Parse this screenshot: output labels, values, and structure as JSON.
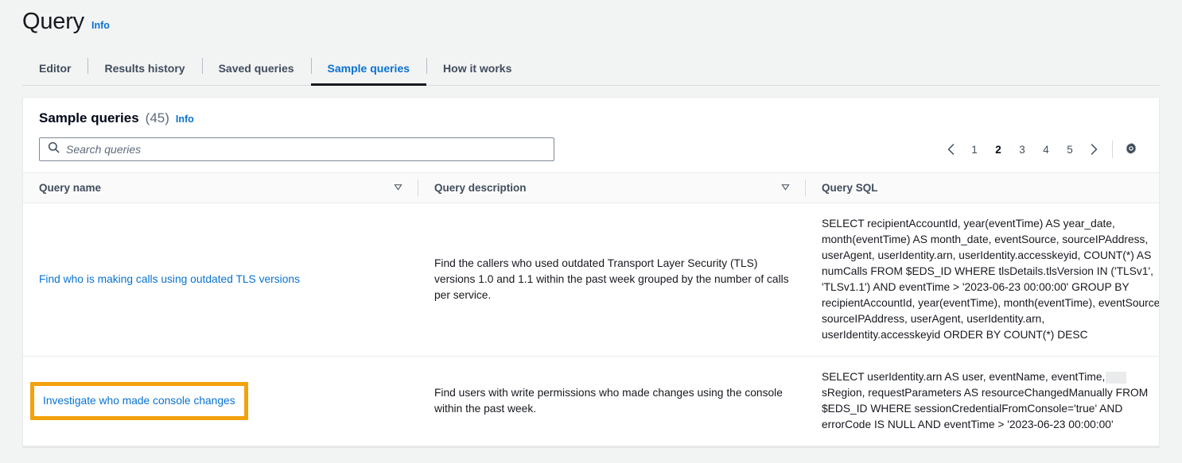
{
  "header": {
    "title": "Query",
    "info_label": "Info"
  },
  "tabs": [
    {
      "label": "Editor",
      "active": false
    },
    {
      "label": "Results history",
      "active": false
    },
    {
      "label": "Saved queries",
      "active": false
    },
    {
      "label": "Sample queries",
      "active": true
    },
    {
      "label": "How it works",
      "active": false
    }
  ],
  "panel": {
    "title": "Sample queries",
    "count": "(45)",
    "info_label": "Info"
  },
  "search": {
    "placeholder": "Search queries",
    "value": "",
    "icon": "search-icon"
  },
  "pagination": {
    "prev_icon": "chevron-left-icon",
    "next_icon": "chevron-right-icon",
    "pages": [
      "1",
      "2",
      "3",
      "4",
      "5"
    ],
    "current_page": "2",
    "settings_icon": "gear-icon"
  },
  "table": {
    "columns": [
      {
        "label": "Query name",
        "sortable": true
      },
      {
        "label": "Query description",
        "sortable": true
      },
      {
        "label": "Query SQL",
        "sortable": false
      }
    ],
    "rows": [
      {
        "name": "Find who is making calls using outdated TLS versions",
        "description": "Find the callers who used outdated Transport Layer Security (TLS) versions 1.0 and 1.1 within the past week grouped by the number of calls per service.",
        "sql_part1": "SELECT recipientAccountId, year(eventTime) AS year_date, month(eventTime) AS month_date, eventSource, sourceIPAddress, userAgent, userIdentity.arn, userIdentity.accesskeyid, COUNT(*) AS numCalls FROM $EDS_ID WHERE tlsDetails.tlsVersion IN ('TLSv1', 'TLSv1.1') AND eventTime > '2023-06-23 00:00:00' GROUP BY recipientAccountId, year(eventTime), month(eventTime), eventSource, sourceIPAddress, userAgent, userIdentity.arn, userIdentity.accesskeyid ORDER BY COUNT(*) DESC",
        "sql_part2": "",
        "highlighted": false,
        "redacted": false
      },
      {
        "name": "Investigate who made console changes",
        "description": "Find users with write permissions who made changes using the console within the past week.",
        "sql_part1": "SELECT userIdentity.arn AS user, eventName, eventTime,",
        "sql_part2": "sRegion, requestParameters AS resourceChangedManually FROM $EDS_ID WHERE sessionCredentialFromConsole='true' AND errorCode IS NULL AND eventTime > '2023-06-23 00:00:00'",
        "highlighted": true,
        "redacted": true
      }
    ]
  },
  "colors": {
    "link": "#0972d3",
    "page_background": "#f2f3f3",
    "panel_background": "#ffffff",
    "highlight_annotation": "#f2a20c",
    "active_tab_underline": "#16191f"
  }
}
